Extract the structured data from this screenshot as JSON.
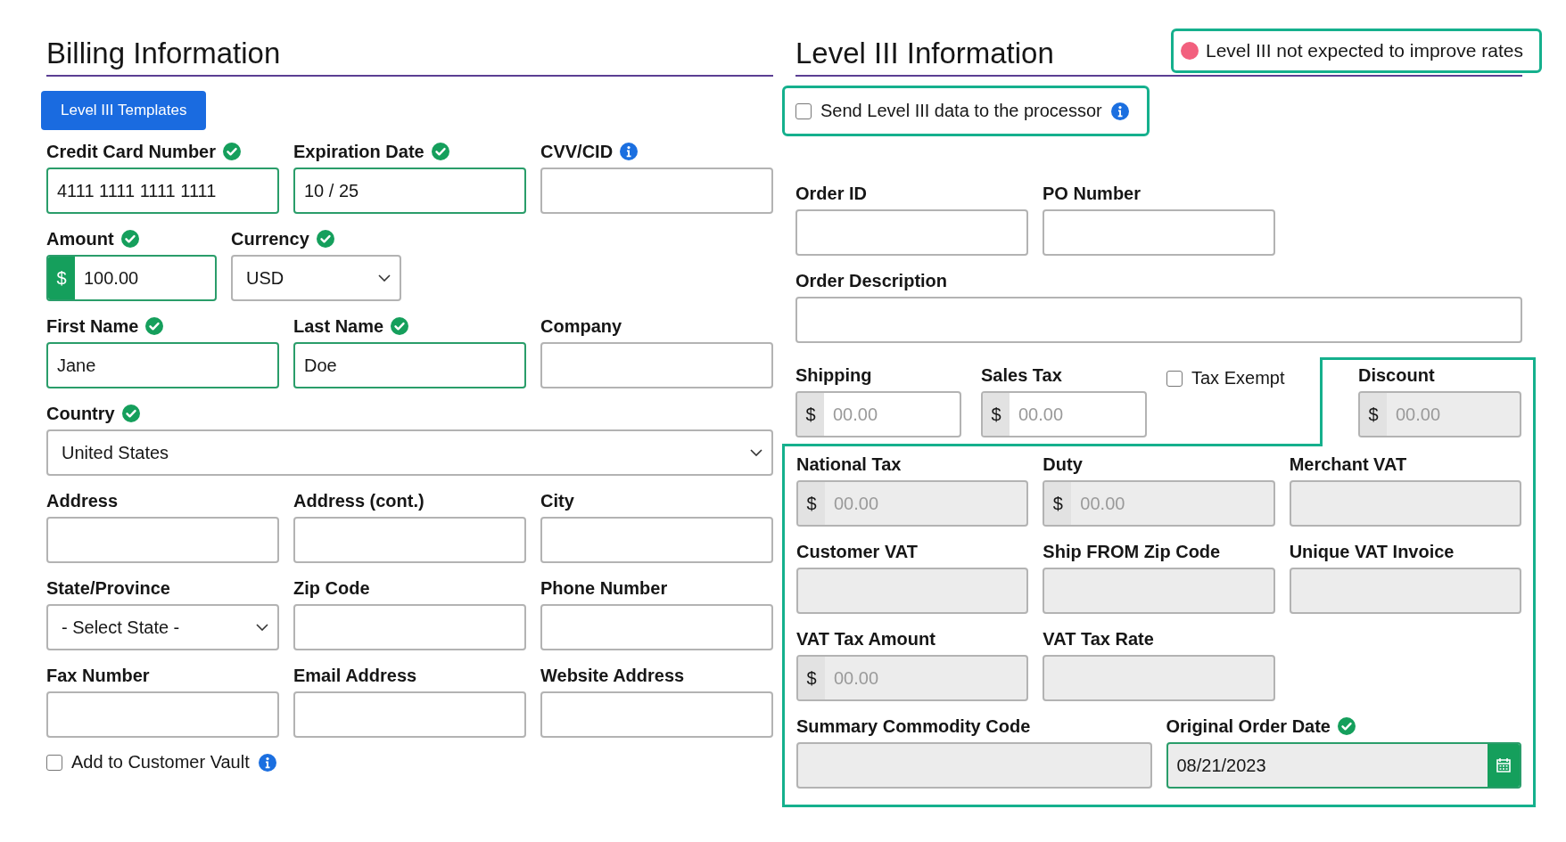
{
  "billing": {
    "title": "Billing Information",
    "templates_button": "Level III Templates",
    "rows": [
      [
        {
          "label": "Credit Card Number",
          "kind": "text",
          "value": "4111 1111 1111 1111",
          "valid": true,
          "info": false
        },
        {
          "label": "Expiration Date",
          "kind": "text",
          "value": "10 / 25",
          "valid": true,
          "info": false
        },
        {
          "label": "CVV/CID",
          "kind": "text",
          "valid": false,
          "info": true
        }
      ],
      [
        {
          "label": "Amount",
          "kind": "money",
          "prefix": "$",
          "value": "100.00",
          "valid": true,
          "info": false
        },
        {
          "label": "Currency",
          "kind": "select",
          "value": "USD",
          "valid": true,
          "info": false
        }
      ],
      [
        {
          "label": "First Name",
          "kind": "text",
          "value": "Jane",
          "valid": true,
          "info": false
        },
        {
          "label": "Last Name",
          "kind": "text",
          "value": "Doe",
          "valid": true,
          "info": false
        },
        {
          "label": "Company",
          "kind": "text",
          "valid": false,
          "info": false
        }
      ],
      [
        {
          "label": "Country",
          "kind": "select",
          "value": "United States",
          "valid": true,
          "info": false
        }
      ],
      [
        {
          "label": "Address",
          "kind": "text",
          "valid": false,
          "info": false
        },
        {
          "label": "Address (cont.)",
          "kind": "text",
          "valid": false,
          "info": false
        },
        {
          "label": "City",
          "kind": "text",
          "valid": false,
          "info": false
        }
      ],
      [
        {
          "label": "State/Province",
          "kind": "select",
          "value": "- Select State -",
          "valid": false,
          "info": false
        },
        {
          "label": "Zip Code",
          "kind": "text",
          "valid": false,
          "info": false
        },
        {
          "label": "Phone Number",
          "kind": "text",
          "valid": false,
          "info": false
        }
      ],
      [
        {
          "label": "Fax Number",
          "kind": "text",
          "valid": false,
          "info": false
        },
        {
          "label": "Email Address",
          "kind": "text",
          "valid": false,
          "info": false
        },
        {
          "label": "Website Address",
          "kind": "text",
          "valid": false,
          "info": false
        }
      ]
    ],
    "vault": {
      "label": "Add to Customer Vault",
      "checked": false,
      "info": true
    }
  },
  "level3": {
    "title": "Level III Information",
    "notice": {
      "text": "Level III not expected to improve rates",
      "color": "#f2607e"
    },
    "send": {
      "label": "Send Level III data to the processor",
      "checked": false,
      "info": true
    },
    "rows": [
      [
        {
          "label": "Order ID",
          "kind": "text",
          "valid": false,
          "info": false,
          "disabled": false
        },
        {
          "label": "PO Number",
          "kind": "text",
          "valid": false,
          "info": false,
          "disabled": false
        }
      ],
      [
        {
          "label": "Order Description",
          "kind": "text",
          "valid": false,
          "info": false,
          "disabled": false
        }
      ]
    ],
    "adjustments": {
      "fields": [
        {
          "label": "Shipping",
          "kind": "money",
          "prefix": "$",
          "placeholder": "00.00",
          "valid": false,
          "info": false,
          "disabled": false
        },
        {
          "label": "Sales Tax",
          "kind": "money",
          "prefix": "$",
          "placeholder": "00.00",
          "valid": false,
          "info": false,
          "disabled": false
        }
      ],
      "tax_exempt": {
        "label": "Tax Exempt",
        "checked": false
      },
      "discount": {
        "label": "Discount",
        "kind": "money",
        "prefix": "$",
        "placeholder": "00.00",
        "valid": false,
        "info": false,
        "disabled": true
      }
    },
    "details": [
      [
        {
          "label": "National Tax",
          "kind": "money",
          "prefix": "$",
          "placeholder": "00.00",
          "valid": false,
          "info": false,
          "disabled": true
        },
        {
          "label": "Duty",
          "kind": "money",
          "prefix": "$",
          "placeholder": "00.00",
          "valid": false,
          "info": false,
          "disabled": true
        },
        {
          "label": "Merchant VAT",
          "kind": "text",
          "valid": false,
          "info": false,
          "disabled": true
        }
      ],
      [
        {
          "label": "Customer VAT",
          "kind": "text",
          "valid": false,
          "info": false,
          "disabled": true
        },
        {
          "label": "Ship FROM Zip Code",
          "kind": "text",
          "valid": false,
          "info": false,
          "disabled": true
        },
        {
          "label": "Unique VAT Invoice",
          "kind": "text",
          "valid": false,
          "info": false,
          "disabled": true
        }
      ],
      [
        {
          "label": "VAT Tax Amount",
          "kind": "money",
          "prefix": "$",
          "placeholder": "00.00",
          "valid": false,
          "info": false,
          "disabled": true
        },
        {
          "label": "VAT Tax Rate",
          "kind": "text",
          "valid": false,
          "info": false,
          "disabled": true
        }
      ],
      [
        {
          "label": "Summary Commodity Code",
          "kind": "text",
          "valid": false,
          "info": false,
          "disabled": true
        },
        {
          "label": "Original Order Date",
          "kind": "date",
          "value": "08/21/2023",
          "valid": true,
          "info": false,
          "disabled": true
        }
      ]
    ]
  }
}
